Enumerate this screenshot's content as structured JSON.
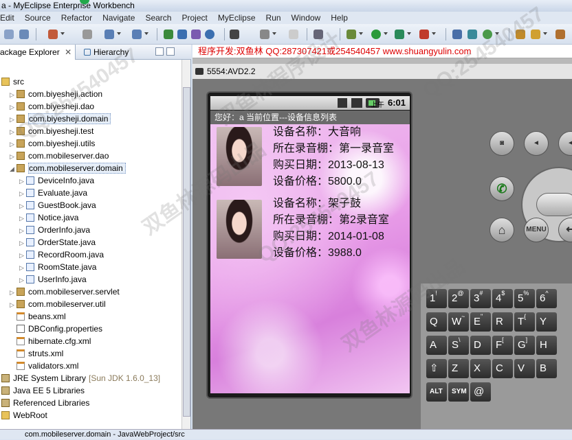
{
  "window": {
    "title": "a - MyEclipse Enterprise Workbench"
  },
  "menu": [
    "Edit",
    "Source",
    "Refactor",
    "Navigate",
    "Search",
    "Project",
    "MyEclipse",
    "Run",
    "Window",
    "Help"
  ],
  "left_view": {
    "tabs": [
      {
        "label": "ackage Explorer",
        "close": "✕"
      },
      {
        "label": "Hierarchy"
      }
    ],
    "tree": [
      {
        "label": "src",
        "icon": "folder-icon"
      },
      {
        "label": "com.biyesheji.action",
        "icon": "package-icon"
      },
      {
        "label": "com.biyesheji.dao",
        "icon": "package-icon"
      },
      {
        "label": "com.biyesheji.domain",
        "icon": "package-icon"
      },
      {
        "label": "com.biyesheji.test",
        "icon": "package-icon"
      },
      {
        "label": "com.biyesheji.utils",
        "icon": "package-icon"
      },
      {
        "label": "com.mobileserver.dao",
        "icon": "package-icon"
      },
      {
        "label": "com.mobileserver.domain",
        "icon": "package-icon"
      },
      {
        "label": "DeviceInfo.java",
        "icon": "java-file-icon"
      },
      {
        "label": "Evaluate.java",
        "icon": "java-file-icon"
      },
      {
        "label": "GuestBook.java",
        "icon": "java-file-icon"
      },
      {
        "label": "Notice.java",
        "icon": "java-file-icon"
      },
      {
        "label": "OrderInfo.java",
        "icon": "java-file-icon"
      },
      {
        "label": "OrderState.java",
        "icon": "java-file-icon"
      },
      {
        "label": "RecordRoom.java",
        "icon": "java-file-icon"
      },
      {
        "label": "RoomState.java",
        "icon": "java-file-icon"
      },
      {
        "label": "UserInfo.java",
        "icon": "java-file-icon"
      },
      {
        "label": "com.mobileserver.servlet",
        "icon": "package-icon"
      },
      {
        "label": "com.mobileserver.util",
        "icon": "package-icon"
      },
      {
        "label": "beans.xml",
        "icon": "xml-file-icon"
      },
      {
        "label": "DBConfig.properties",
        "icon": "properties-file-icon"
      },
      {
        "label": "hibernate.cfg.xml",
        "icon": "xml-file-icon"
      },
      {
        "label": "struts.xml",
        "icon": "xml-file-icon"
      },
      {
        "label": "validators.xml",
        "icon": "xml-file-icon"
      },
      {
        "label": "JRE System Library",
        "suffix": "[Sun JDK 1.6.0_13]",
        "icon": "library-icon"
      },
      {
        "label": "Java EE 5 Libraries",
        "icon": "library-icon"
      },
      {
        "label": "Referenced Libraries",
        "icon": "library-icon"
      },
      {
        "label": "WebRoot",
        "icon": "folder-icon"
      }
    ]
  },
  "promo": "程序开发:双鱼林 QQ:287307421或254540457 www.shuangyulin.com",
  "emulator": {
    "title": "5554:AVD2.2",
    "status_time": "6:01",
    "status_ampm": "上午",
    "app_header": "您好：a    当前位置---设备信息列表",
    "devices": [
      {
        "name": "设备名称：大音响",
        "room": "所在录音棚：第一录音室",
        "date": "购买日期：2013-08-13",
        "price": "设备价格：5800.0"
      },
      {
        "name": "设备名称：架子鼓",
        "room": "所在录音棚：第2录音室",
        "date": "购买日期：2014-01-08",
        "price": "设备价格：3988.0"
      }
    ],
    "menu_button": "MENU",
    "keys": [
      {
        "label": "1",
        "sup": "!"
      },
      {
        "label": "2",
        "sup": "@"
      },
      {
        "label": "3",
        "sup": "#"
      },
      {
        "label": "4",
        "sup": "$"
      },
      {
        "label": "5",
        "sup": "%"
      },
      {
        "label": "6",
        "sup": "^"
      },
      {
        "label": "Q",
        "sup": ""
      },
      {
        "label": "W",
        "sup": "~"
      },
      {
        "label": "E",
        "sup": "\""
      },
      {
        "label": "R",
        "sup": ""
      },
      {
        "label": "T",
        "sup": "{"
      },
      {
        "label": "Y",
        "sup": ""
      },
      {
        "label": "A",
        "sup": ""
      },
      {
        "label": "S",
        "sup": "\\"
      },
      {
        "label": "D",
        "sup": ""
      },
      {
        "label": "F",
        "sup": "["
      },
      {
        "label": "G",
        "sup": "]"
      },
      {
        "label": "H",
        "sup": ""
      },
      {
        "label": "⇧",
        "sup": ""
      },
      {
        "label": "Z",
        "sup": ""
      },
      {
        "label": "X",
        "sup": ""
      },
      {
        "label": "C",
        "sup": ""
      },
      {
        "label": "V",
        "sup": ""
      },
      {
        "label": "B",
        "sup": ""
      },
      {
        "label": "ALT",
        "sup": ""
      },
      {
        "label": "SYM",
        "sup": ""
      },
      {
        "label": "@",
        "sup": ""
      }
    ]
  },
  "statusline": "com.mobileserver.domain - JavaWebProject/src",
  "watermarks": [
    "QQ:254540457",
    "双鱼林程序设计",
    "双鱼林源码出品",
    "QQ:254540457",
    "双鱼林源码出品",
    "QQ:254540457"
  ]
}
